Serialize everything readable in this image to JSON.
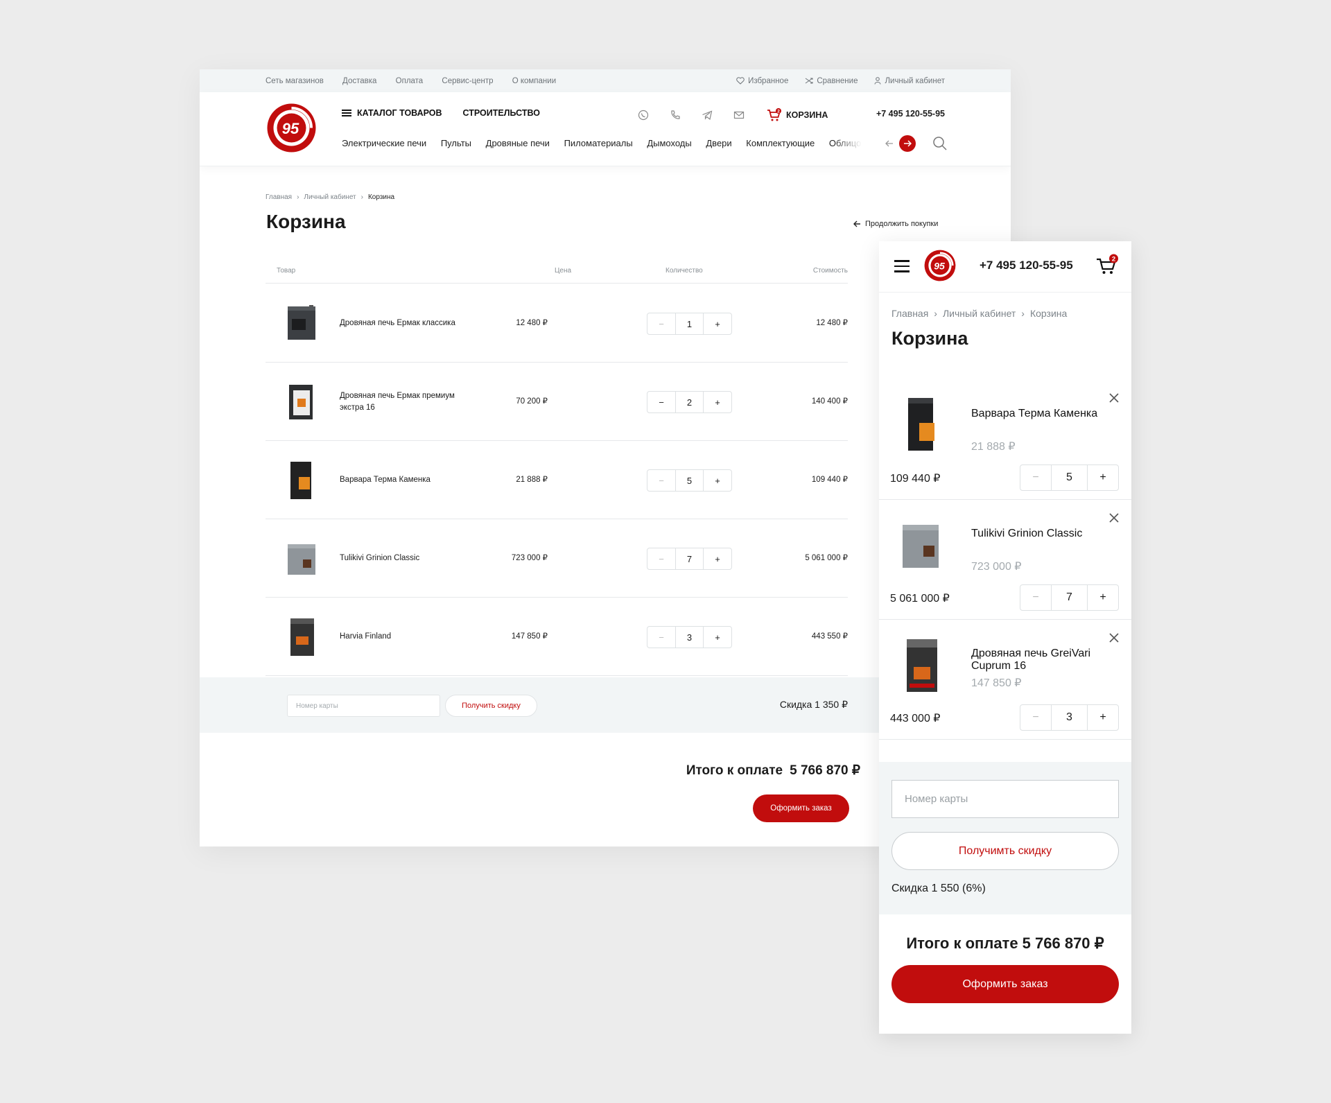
{
  "brand_color": "#c10d0d",
  "logo_text": "95",
  "topbar": {
    "links": [
      "Сеть магазинов",
      "Доставка",
      "Оплата",
      "Сервис-центр",
      "О компании"
    ],
    "favorites": "Избранное",
    "compare": "Сравнение",
    "account": "Личный кабинет"
  },
  "header": {
    "catalog": "КАТАЛОГ ТОВАРОВ",
    "construction": "СТРОИТЕЛЬСТВО",
    "cart": "КОРЗИНА",
    "cart_count": "2",
    "phone": "+7 495 120-55-95",
    "nav": [
      "Электрические печи",
      "Пульты",
      "Дровяные печи",
      "Пиломатериалы",
      "Дымоходы",
      "Двери",
      "Комплектующие",
      "Облицо"
    ]
  },
  "breadcrumbs": {
    "home": "Главная",
    "account": "Личный кабинет",
    "current": "Корзина"
  },
  "page_title": "Корзина",
  "continue_shopping": "Продолжить покупки",
  "table": {
    "headers": {
      "product": "Товар",
      "price": "Цена",
      "qty": "Количество",
      "total": "Стоимость"
    },
    "rows": [
      {
        "name": "Дровяная печь Ермак классика",
        "price": "12 480 ₽",
        "qty": "1",
        "total": "12 480 ₽"
      },
      {
        "name": "Дровяная печь Ермак премиум экстра 16",
        "price": "70 200 ₽",
        "qty": "2",
        "total": "140 400 ₽"
      },
      {
        "name": "Варвара Терма Каменка",
        "price": "21 888 ₽",
        "qty": "5",
        "total": "109 440 ₽"
      },
      {
        "name": "Tulikivi Grinion Classic",
        "price": "723 000 ₽",
        "qty": "7",
        "total": "5 061 000 ₽"
      },
      {
        "name": "Harvia Finland",
        "price": "147 850 ₽",
        "qty": "3",
        "total": "443 550 ₽"
      }
    ]
  },
  "discount": {
    "card_placeholder": "Номер карты",
    "button": "Получить скидку",
    "text": "Скидка 1 350 ₽"
  },
  "total": {
    "label": "Итого к оплате",
    "value": "5 766 870 ₽"
  },
  "order_button": "Оформить заказ",
  "stepper": {
    "minus": "−",
    "plus": "+"
  },
  "mobile": {
    "phone": "+7 495 120-55-95",
    "cart_count": "2",
    "items": [
      {
        "name": "Варвара Терма Каменка",
        "price": "21 888 ₽",
        "qty": "5",
        "sum": "109 440 ₽"
      },
      {
        "name": "Tulikivi Grinion Classic",
        "price": "723 000 ₽",
        "qty": "7",
        "sum": "5 061 000 ₽"
      },
      {
        "name": "Дровяная печь GreiVari Cuprum 16",
        "price": "147 850 ₽",
        "qty": "3",
        "sum": "443 000 ₽"
      }
    ],
    "card_placeholder": "Номер карты",
    "discount_button": "Получимть скидку",
    "discount_text": "Скидка 1 550 (6%)",
    "total": "Итого к оплате 5 766 870 ₽",
    "order_button": "Оформить заказ"
  }
}
